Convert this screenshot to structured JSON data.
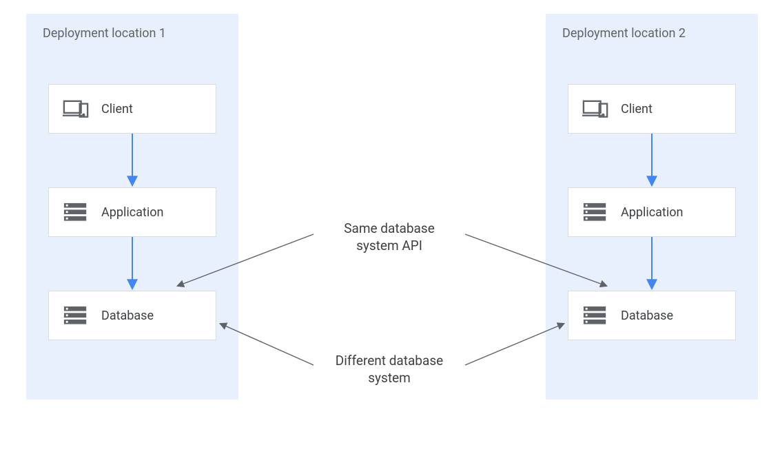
{
  "regions": {
    "left": {
      "title": "Deployment location 1"
    },
    "right": {
      "title": "Deployment location 2"
    }
  },
  "nodes": {
    "client": {
      "label": "Client"
    },
    "application": {
      "label": "Application"
    },
    "database": {
      "label": "Database"
    }
  },
  "annotations": {
    "same_api": "Same database\nsystem API",
    "diff_system": "Different database\nsystem"
  },
  "colors": {
    "region_bg": "#e8f0fe",
    "node_border": "#dadce0",
    "arrow_blue": "#4285f4",
    "arrow_gray": "#5f6368",
    "icon_gray": "#5f6368"
  }
}
